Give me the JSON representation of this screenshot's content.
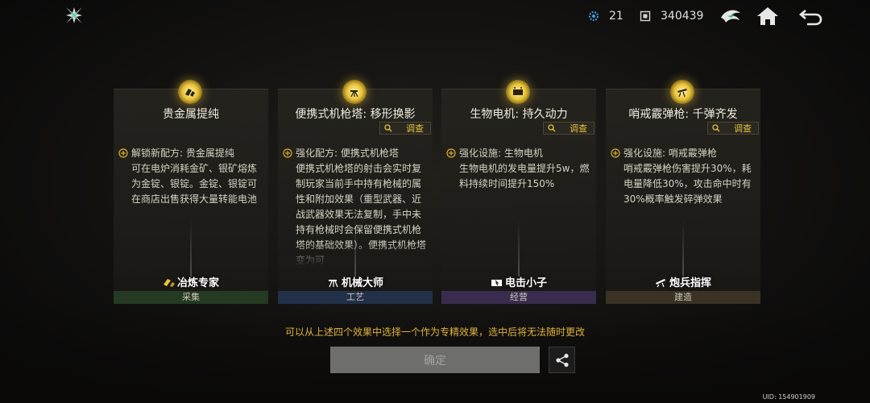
{
  "top_bar": {
    "logo_icon": "starburst-logo-icon",
    "stat_1_value": "21",
    "stat_1_icon": "blue-gear-icon",
    "stat_2_value": "340439",
    "stat_2_icon": "chip-icon",
    "buttons": [
      "hawk-emblem-icon",
      "home-icon",
      "back-icon"
    ]
  },
  "inspect_label": "调查",
  "cards": [
    {
      "title": "贵金属提纯",
      "has_inspect": false,
      "body": "解锁新配方: 贵金属提纯\n可在电炉消耗金矿、银矿熔炼为金锭、银锭。金锭、银锭可在商店出售获得大量转能电池",
      "role_name": "冶炼专家",
      "category": "采集",
      "category_color": "#243a22"
    },
    {
      "title": "便携式机枪塔: 移形换影",
      "has_inspect": true,
      "body": "强化配方: 便携式机枪塔\n便携式机枪塔的射击会实时复制玩家当前手中持有枪械的属性和附加效果（重型武器、近战武器效果无法复制，手中未持有枪械时会保留便携式机枪塔的基础效果）。便携式机枪塔变为可",
      "role_name": "机械大师",
      "category": "工艺",
      "category_color": "#22304a"
    },
    {
      "title": "生物电机: 持久动力",
      "has_inspect": true,
      "body": "强化设施: 生物电机\n生物电机的发电量提升5w，燃料持续时间提升150%",
      "role_name": "电击小子",
      "category": "经营",
      "category_color": "#3a2c4e"
    },
    {
      "title": "哨戒霰弹枪: 千弹齐发",
      "has_inspect": true,
      "body": "强化设施: 哨戒霰弹枪\n哨戒霰弹枪伤害提升30%，耗电量降低30%，攻击命中时有30%概率触发碎弹效果",
      "role_name": "炮兵指挥",
      "category": "建造",
      "category_color": "#3a3224"
    }
  ],
  "notice": "可以从上述四个效果中选择一个作为专精效果，选中后将无法随时更改",
  "confirm_label": "确定",
  "uid": "UID: 154901909",
  "colors": {
    "accent_gold": "#e8c240",
    "notice": "#e0b43a",
    "confirm_bg": "#6e6e6c"
  }
}
